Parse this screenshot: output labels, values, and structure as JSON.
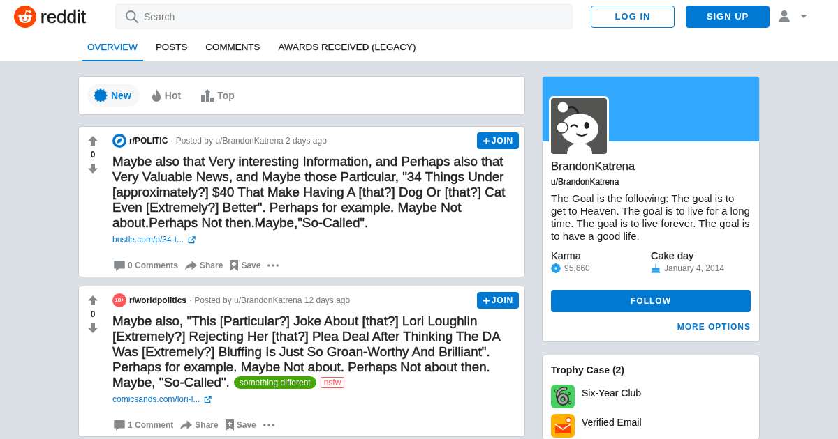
{
  "header": {
    "logo_text": "reddit",
    "search": {
      "placeholder": "Search"
    },
    "buttons": [
      {
        "kind": "log_in",
        "label": "LOG IN"
      },
      {
        "kind": "sign_up",
        "label": "SIGN UP"
      }
    ]
  },
  "tabs": [
    {
      "label": "OVERVIEW",
      "selected": true
    },
    {
      "label": "POSTS",
      "selected": false
    },
    {
      "label": "COMMENTS",
      "selected": false
    },
    {
      "label": "AWARDS RECEIVED (LEGACY)",
      "selected": false
    }
  ],
  "sort_options": [
    {
      "kind": "new",
      "label": "New",
      "selected": true
    },
    {
      "kind": "hot",
      "label": "Hot",
      "selected": false
    },
    {
      "kind": "top",
      "label": "Top",
      "selected": false
    }
  ],
  "posts": [
    {
      "votes": "0",
      "community_icon": {
        "kind": "community"
      },
      "subreddit": "r/POLITIC",
      "meta": "· Posted by u/BrandonKatrena 2 days ago",
      "join_label": "JOIN",
      "title": "Maybe also that Very interesting Information, and Perhaps also that Very Valuable News, and Maybe those Particular, \"34 Things Under [approximately?] $40 That Make Having A [that?] Dog Or [that?] Cat Even [Extremely?] Better\". Perhaps for example. Maybe Not about.Perhaps Not then.Maybe,\"So-Called\".",
      "link": "bustle.com/p/34-t...",
      "actions": [
        {
          "kind": "comments",
          "label": "0 Comments"
        },
        {
          "kind": "share",
          "label": "Share"
        },
        {
          "kind": "save",
          "label": "Save"
        },
        {
          "kind": "more"
        }
      ]
    },
    {
      "votes": "0",
      "community_icon": {
        "kind": "nsfw",
        "text": "18+"
      },
      "subreddit": "r/worldpolitics",
      "meta": "· Posted by u/BrandonKatrena 12 days ago",
      "join_label": "JOIN",
      "title": "Maybe also, \"This [Particular?] Joke About [that?] Lori Loughlin [Extremely?] Rejecting Her [that?] Plea Deal After Thinking The DA Was [Extremely?] Bluffing Is Just So Groan-Worthy And Brilliant\". Perhaps for example. Maybe Not about. Perhaps Not about then. Maybe, \"So-Called\".",
      "tags": [
        {
          "kind": "flair",
          "text": "something different"
        },
        {
          "kind": "nsfw",
          "text": "nsfw"
        }
      ],
      "link": "comicsands.com/lori-l...",
      "actions": [
        {
          "kind": "comments",
          "label": "1 Comment"
        },
        {
          "kind": "share",
          "label": "Share"
        },
        {
          "kind": "save",
          "label": "Save"
        },
        {
          "kind": "more"
        }
      ]
    }
  ],
  "profile": {
    "display_name": "BrandonKatrena",
    "username": "u/BrandonKatrena",
    "description": "The Goal is the following: The goal is to get to Heaven. The goal is to live for a long time. The goal is to live forever. The goal is to have a good life.",
    "stats": [
      {
        "kind": "karma",
        "label": "Karma",
        "value": "95,660"
      },
      {
        "kind": "cake_day",
        "label": "Cake day",
        "value": "January 4, 2014"
      }
    ],
    "follow_label": "FOLLOW",
    "more_options": "MORE OPTIONS"
  },
  "trophy_case": {
    "title": "Trophy Case (2)",
    "trophies": [
      {
        "kind": "six_year",
        "name": "Six-Year Club"
      },
      {
        "kind": "verified_email",
        "name": "Verified Email"
      }
    ]
  }
}
